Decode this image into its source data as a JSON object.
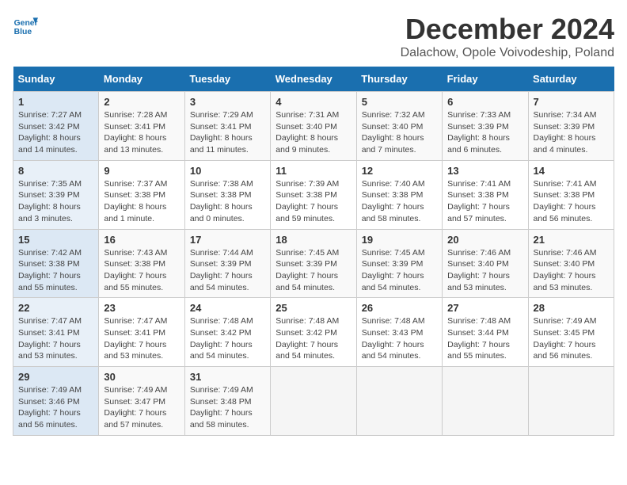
{
  "header": {
    "logo_line1": "General",
    "logo_line2": "Blue",
    "month_title": "December 2024",
    "subtitle": "Dalachow, Opole Voivodeship, Poland"
  },
  "calendar": {
    "days_of_week": [
      "Sunday",
      "Monday",
      "Tuesday",
      "Wednesday",
      "Thursday",
      "Friday",
      "Saturday"
    ],
    "weeks": [
      [
        null,
        {
          "day": "2",
          "sunrise": "7:28 AM",
          "sunset": "3:41 PM",
          "daylight": "8 hours and 13 minutes."
        },
        {
          "day": "3",
          "sunrise": "7:29 AM",
          "sunset": "3:41 PM",
          "daylight": "8 hours and 11 minutes."
        },
        {
          "day": "4",
          "sunrise": "7:31 AM",
          "sunset": "3:40 PM",
          "daylight": "8 hours and 9 minutes."
        },
        {
          "day": "5",
          "sunrise": "7:32 AM",
          "sunset": "3:40 PM",
          "daylight": "8 hours and 7 minutes."
        },
        {
          "day": "6",
          "sunrise": "7:33 AM",
          "sunset": "3:39 PM",
          "daylight": "8 hours and 6 minutes."
        },
        {
          "day": "7",
          "sunrise": "7:34 AM",
          "sunset": "3:39 PM",
          "daylight": "8 hours and 4 minutes."
        }
      ],
      [
        {
          "day": "1",
          "sunrise": "7:27 AM",
          "sunset": "3:42 PM",
          "daylight": "8 hours and 14 minutes."
        },
        {
          "day": "8",
          "sunrise": "7:35 AM",
          "sunset": "3:39 PM",
          "daylight": "8 hours and 3 minutes."
        },
        {
          "day": "9",
          "sunrise": "7:37 AM",
          "sunset": "3:38 PM",
          "daylight": "8 hours and 1 minute."
        },
        {
          "day": "10",
          "sunrise": "7:38 AM",
          "sunset": "3:38 PM",
          "daylight": "8 hours and 0 minutes."
        },
        {
          "day": "11",
          "sunrise": "7:39 AM",
          "sunset": "3:38 PM",
          "daylight": "7 hours and 59 minutes."
        },
        {
          "day": "12",
          "sunrise": "7:40 AM",
          "sunset": "3:38 PM",
          "daylight": "7 hours and 58 minutes."
        },
        {
          "day": "13",
          "sunrise": "7:41 AM",
          "sunset": "3:38 PM",
          "daylight": "7 hours and 57 minutes."
        }
      ],
      [
        {
          "day": "14",
          "sunrise": "7:41 AM",
          "sunset": "3:38 PM",
          "daylight": "7 hours and 56 minutes."
        },
        {
          "day": "15",
          "sunrise": "7:42 AM",
          "sunset": "3:38 PM",
          "daylight": "7 hours and 55 minutes."
        },
        {
          "day": "16",
          "sunrise": "7:43 AM",
          "sunset": "3:38 PM",
          "daylight": "7 hours and 55 minutes."
        },
        {
          "day": "17",
          "sunrise": "7:44 AM",
          "sunset": "3:39 PM",
          "daylight": "7 hours and 54 minutes."
        },
        {
          "day": "18",
          "sunrise": "7:45 AM",
          "sunset": "3:39 PM",
          "daylight": "7 hours and 54 minutes."
        },
        {
          "day": "19",
          "sunrise": "7:45 AM",
          "sunset": "3:39 PM",
          "daylight": "7 hours and 54 minutes."
        },
        {
          "day": "20",
          "sunrise": "7:46 AM",
          "sunset": "3:40 PM",
          "daylight": "7 hours and 53 minutes."
        }
      ],
      [
        {
          "day": "21",
          "sunrise": "7:46 AM",
          "sunset": "3:40 PM",
          "daylight": "7 hours and 53 minutes."
        },
        {
          "day": "22",
          "sunrise": "7:47 AM",
          "sunset": "3:41 PM",
          "daylight": "7 hours and 53 minutes."
        },
        {
          "day": "23",
          "sunrise": "7:47 AM",
          "sunset": "3:41 PM",
          "daylight": "7 hours and 53 minutes."
        },
        {
          "day": "24",
          "sunrise": "7:48 AM",
          "sunset": "3:42 PM",
          "daylight": "7 hours and 54 minutes."
        },
        {
          "day": "25",
          "sunrise": "7:48 AM",
          "sunset": "3:42 PM",
          "daylight": "7 hours and 54 minutes."
        },
        {
          "day": "26",
          "sunrise": "7:48 AM",
          "sunset": "3:43 PM",
          "daylight": "7 hours and 54 minutes."
        },
        {
          "day": "27",
          "sunrise": "7:48 AM",
          "sunset": "3:44 PM",
          "daylight": "7 hours and 55 minutes."
        }
      ],
      [
        {
          "day": "28",
          "sunrise": "7:49 AM",
          "sunset": "3:45 PM",
          "daylight": "7 hours and 56 minutes."
        },
        {
          "day": "29",
          "sunrise": "7:49 AM",
          "sunset": "3:46 PM",
          "daylight": "7 hours and 56 minutes."
        },
        {
          "day": "30",
          "sunrise": "7:49 AM",
          "sunset": "3:47 PM",
          "daylight": "7 hours and 57 minutes."
        },
        {
          "day": "31",
          "sunrise": "7:49 AM",
          "sunset": "3:48 PM",
          "daylight": "7 hours and 58 minutes."
        },
        null,
        null,
        null
      ]
    ]
  }
}
